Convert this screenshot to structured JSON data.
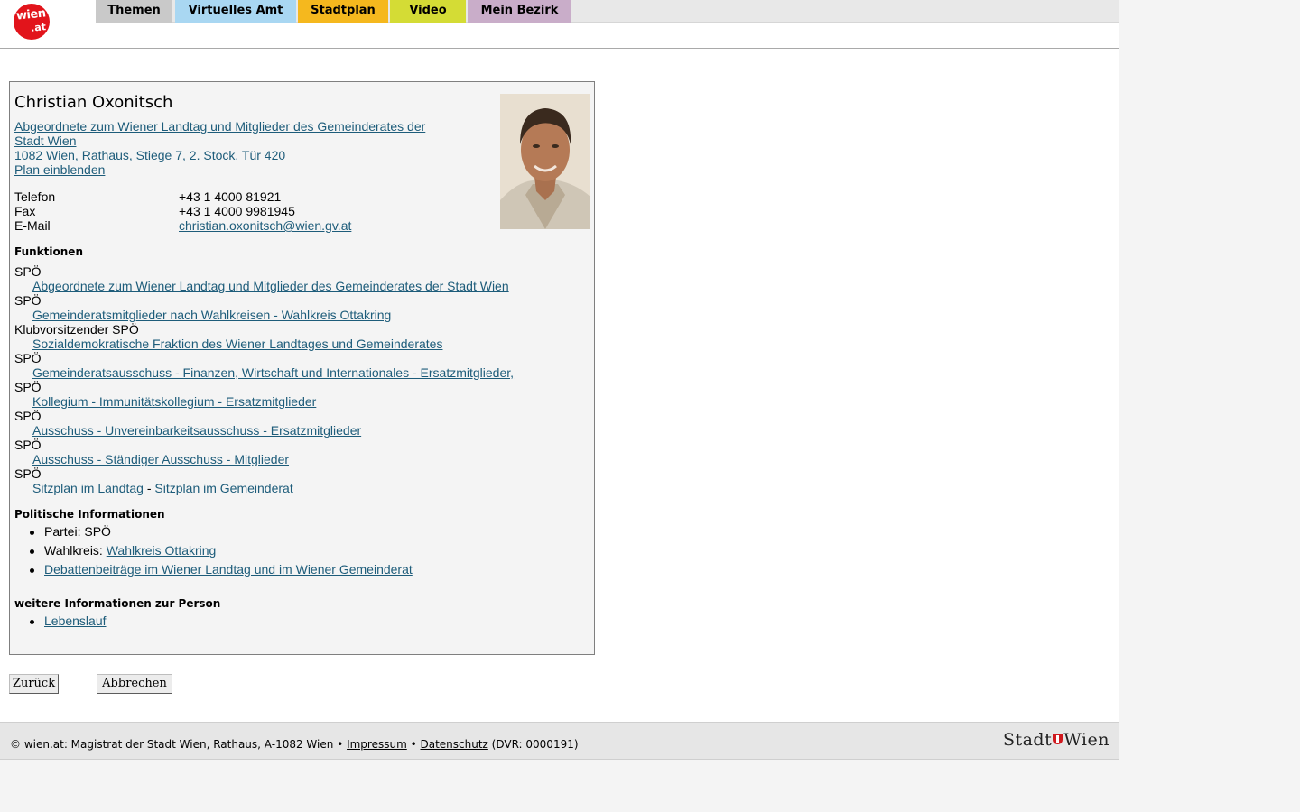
{
  "brand": {
    "logo_line1": "wien",
    "logo_line2": ".at"
  },
  "nav": {
    "tabs": [
      {
        "label": "Themen",
        "color": "#c9c9c9"
      },
      {
        "label": "Virtuelles Amt",
        "color": "#a9d7f2"
      },
      {
        "label": "Stadtplan",
        "color": "#f5b81e"
      },
      {
        "label": "Video",
        "color": "#d4dc35"
      },
      {
        "label": "Mein Bezirk",
        "color": "#c9adc9"
      }
    ]
  },
  "person": {
    "name": "Christian Oxonitsch",
    "org_link_line1": "Abgeordnete zum Wiener Landtag und Mitglieder des Gemeinderates der",
    "org_link_line2": "Stadt Wien",
    "address": "1082 Wien, Rathaus, Stiege 7, 2. Stock, Tür 420",
    "plan_link": "Plan einblenden",
    "contact": {
      "phone_label": "Telefon",
      "phone": "+43 1 4000 81921",
      "fax_label": "Fax",
      "fax": "+43 1 4000 9981945",
      "email_label": "E-Mail",
      "email": "christian.oxonitsch@wien.gv.at"
    }
  },
  "functions": {
    "title": "Funktionen",
    "items": [
      {
        "role": "SPÖ",
        "link": "Abgeordnete zum Wiener Landtag und Mitglieder des Gemeinderates der Stadt Wien"
      },
      {
        "role": "SPÖ",
        "link": "Gemeinderatsmitglieder nach Wahlkreisen - Wahlkreis Ottakring"
      },
      {
        "role": "Klubvorsitzender SPÖ",
        "link": "Sozialdemokratische Fraktion des Wiener Landtages und Gemeinderates"
      },
      {
        "role": "SPÖ",
        "link": "Gemeinderatsausschuss - Finanzen, Wirtschaft und Internationales - Ersatzmitglieder,"
      },
      {
        "role": "SPÖ",
        "link": "Kollegium - Immunitätskollegium - Ersatzmitglieder"
      },
      {
        "role": "SPÖ",
        "link": "Ausschuss - Unvereinbarkeitsausschuss - Ersatzmitglieder"
      },
      {
        "role": "SPÖ",
        "link": "Ausschuss - Ständiger Ausschuss - Mitglieder"
      }
    ],
    "last_role": "SPÖ",
    "seat_landtag": "Sitzplan im Landtag",
    "seat_separator": " - ",
    "seat_gemeinderat": "Sitzplan im Gemeinderat"
  },
  "political": {
    "title": "Politische Informationen",
    "party": "Partei: SPÖ",
    "district_label": "Wahlkreis: ",
    "district_link": "Wahlkreis Ottakring",
    "debates_link": "Debattenbeiträge im Wiener Landtag und im Wiener Gemeinderat"
  },
  "more": {
    "title": "weitere Informationen zur Person",
    "cv_link": "Lebenslauf"
  },
  "buttons": {
    "back": "Zurück",
    "cancel": "Abbrechen"
  },
  "footer": {
    "prefix": "© wien.at: Magistrat der Stadt Wien, Rathaus, A-1082 Wien • ",
    "impressum": "Impressum",
    "sep": " • ",
    "datenschutz": "Datenschutz",
    "suffix": " (DVR: 0000191)",
    "logo_left": "Stadt",
    "logo_right": "Wien"
  }
}
